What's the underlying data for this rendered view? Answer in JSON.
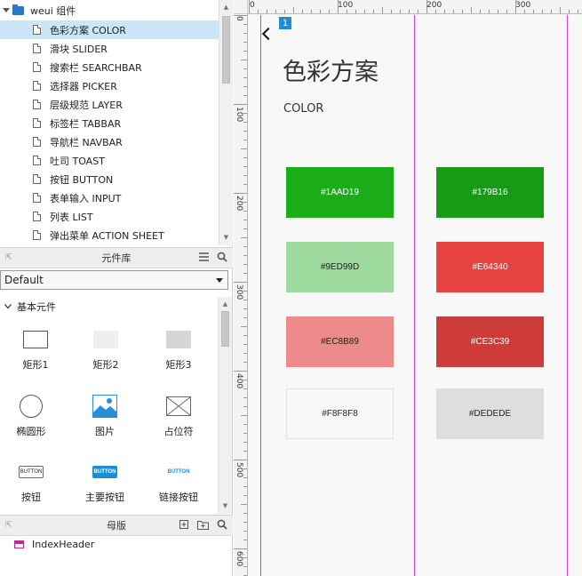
{
  "pages": {
    "root_label": "weui 组件",
    "items": [
      {
        "label": "色彩方案 COLOR",
        "selected": true
      },
      {
        "label": "滑块 SLIDER"
      },
      {
        "label": "搜索栏 SEARCHBAR"
      },
      {
        "label": "选择器 PICKER"
      },
      {
        "label": "层级规范 LAYER"
      },
      {
        "label": "标签栏 TABBAR"
      },
      {
        "label": "导航栏 NAVBAR"
      },
      {
        "label": "吐司 TOAST"
      },
      {
        "label": "按钮 BUTTON"
      },
      {
        "label": "表单输入 INPUT"
      },
      {
        "label": "列表 LIST"
      },
      {
        "label": "弹出菜单 ACTION SHEET"
      }
    ]
  },
  "library": {
    "title": "元件库",
    "selected_library": "Default",
    "category": "基本元件",
    "widgets": [
      {
        "label": "矩形1",
        "icon": "rectangle-outline-icon"
      },
      {
        "label": "矩形2",
        "icon": "rectangle-light-fill-icon"
      },
      {
        "label": "矩形3",
        "icon": "rectangle-gray-fill-icon"
      },
      {
        "label": "椭圆形",
        "icon": "ellipse-icon"
      },
      {
        "label": "图片",
        "icon": "image-icon"
      },
      {
        "label": "占位符",
        "icon": "placeholder-icon"
      },
      {
        "label": "按钮",
        "icon": "button-icon",
        "text": "BUTTON"
      },
      {
        "label": "主要按钮",
        "icon": "primary-button-icon",
        "text": "BUTTON"
      },
      {
        "label": "链接按钮",
        "icon": "link-button-icon",
        "text": "BUTTON"
      }
    ]
  },
  "masters": {
    "title": "母版",
    "items": [
      {
        "label": "IndexHeader"
      }
    ]
  },
  "rulers": {
    "top": [
      "0",
      "100",
      "200",
      "300"
    ],
    "left": [
      "0",
      "100",
      "200",
      "300",
      "400",
      "500",
      "600"
    ]
  },
  "canvas": {
    "badge": "1",
    "title": "色彩方案",
    "subtitle": "COLOR",
    "swatches": [
      {
        "label": "#1AAD19",
        "color": "#1AAD19",
        "text_color": "#ffffff"
      },
      {
        "label": "#179B16",
        "color": "#179B16",
        "text_color": "#ffffff"
      },
      {
        "label": "#9ED99D",
        "color": "#9ED99D",
        "text_color": "#222222"
      },
      {
        "label": "#E64340",
        "color": "#E64340",
        "text_color": "#ffffff"
      },
      {
        "label": "#EC8B89",
        "color": "#EC8B89",
        "text_color": "#222222"
      },
      {
        "label": "#CE3C39",
        "color": "#CE3C39",
        "text_color": "#ffffff"
      },
      {
        "label": "#F8F8F8",
        "color": "#F8F8F8",
        "text_color": "#222222"
      },
      {
        "label": "#DEDEDE",
        "color": "#DEDEDE",
        "text_color": "#222222"
      }
    ],
    "guide_color": "#D13FD4"
  }
}
